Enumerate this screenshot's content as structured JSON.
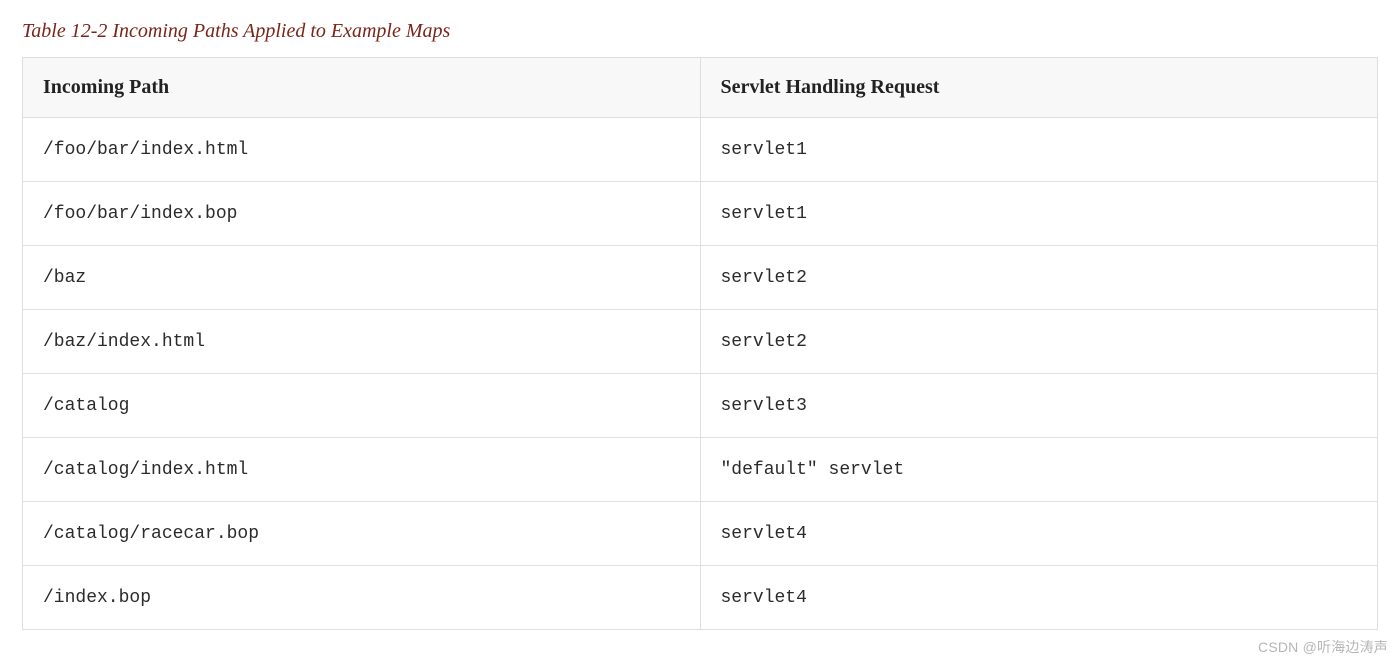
{
  "caption": "Table 12-2 Incoming Paths Applied to Example Maps",
  "headers": {
    "path": "Incoming Path",
    "servlet": "Servlet Handling Request"
  },
  "rows": [
    {
      "path": "/foo/bar/index.html",
      "servlet": "servlet1"
    },
    {
      "path": "/foo/bar/index.bop",
      "servlet": "servlet1"
    },
    {
      "path": "/baz",
      "servlet": "servlet2"
    },
    {
      "path": "/baz/index.html",
      "servlet": "servlet2"
    },
    {
      "path": "/catalog",
      "servlet": "servlet3"
    },
    {
      "path": "/catalog/index.html",
      "servlet": "\"default\" servlet"
    },
    {
      "path": "/catalog/racecar.bop",
      "servlet": "servlet4"
    },
    {
      "path": "/index.bop",
      "servlet": "servlet4"
    }
  ],
  "watermark": "CSDN @听海边涛声"
}
